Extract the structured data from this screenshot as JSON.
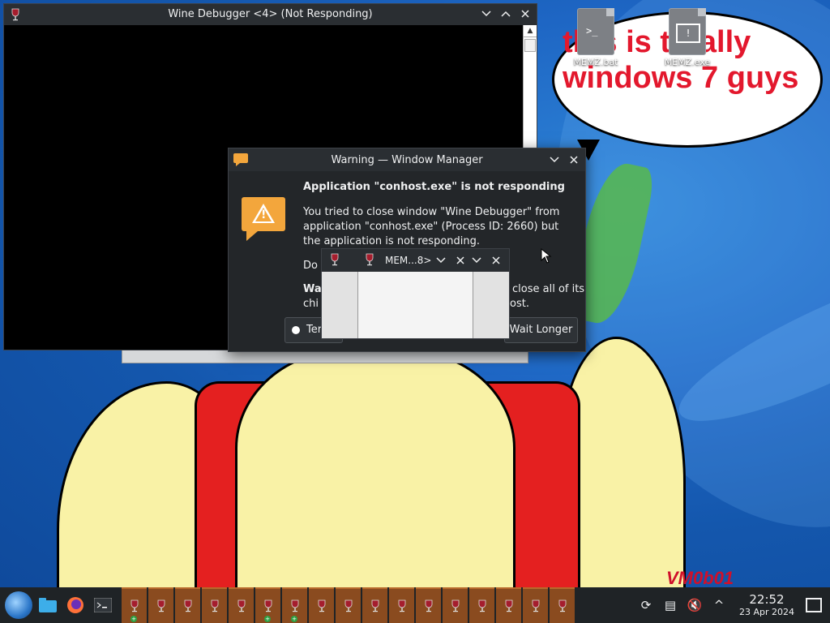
{
  "desktop": {
    "icons": [
      {
        "label": "MEMZ.bat"
      },
      {
        "label": "MEMZ.exe"
      }
    ],
    "bubble_text": "this is totally windows 7 guys",
    "watermark": "VM0b01"
  },
  "wine_debugger": {
    "title": "Wine Debugger <4> (Not Responding)"
  },
  "warning_dialog": {
    "title": "Warning — Window Manager",
    "heading": "Application \"conhost.exe\" is not responding",
    "body": "You tried to close window \"Wine Debugger\" from application \"conhost.exe\" (Process ID: 2660) but the application is not responding.",
    "line_do": "Do",
    "line_close_prefix": "Wa",
    "line_close_suffix": "close all of its",
    "line_host_prefix": "chi",
    "line_host_suffix": "ost.",
    "terminate_label": "Ter",
    "wait_label": "Wait Longer"
  },
  "memz_window": {
    "title": "MEM...8>"
  },
  "taskbar": {
    "wine_buttons": [
      {
        "badge": true
      },
      {
        "badge": false
      },
      {
        "badge": false
      },
      {
        "badge": false
      },
      {
        "badge": false
      },
      {
        "badge": true
      },
      {
        "badge": true
      },
      {
        "badge": false
      },
      {
        "badge": false
      },
      {
        "badge": false
      },
      {
        "badge": false
      },
      {
        "badge": false
      },
      {
        "badge": false
      },
      {
        "badge": false
      },
      {
        "badge": false
      },
      {
        "badge": false
      },
      {
        "badge": false
      }
    ],
    "clock_time": "22:52",
    "clock_date": "23 Apr 2024"
  }
}
